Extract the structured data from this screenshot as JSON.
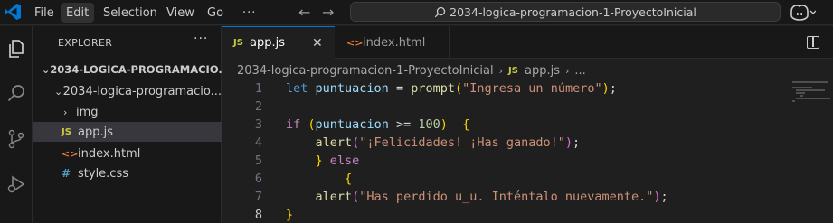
{
  "titlebar": {
    "menu": [
      "File",
      "Edit",
      "Selection",
      "View",
      "Go"
    ],
    "more": "···",
    "search_text": "2034-logica-programacion-1-ProyectoInicial",
    "brand_color": "#0078d4"
  },
  "explorer": {
    "title": "EXPLORER",
    "more": "···",
    "root_label": "2034-LOGICA-PROGRAMACIO...",
    "folder_label": "2034-logica-programacio...",
    "items": [
      {
        "label": "img",
        "type": "folder"
      },
      {
        "label": "app.js",
        "type": "js",
        "icon": "JS"
      },
      {
        "label": "index.html",
        "type": "html",
        "icon": "<>"
      },
      {
        "label": "style.css",
        "type": "css",
        "icon": "#"
      }
    ]
  },
  "tabs": [
    {
      "label": "app.js",
      "icon": "JS",
      "close": "✕"
    },
    {
      "label": "index.html",
      "icon": "<>"
    }
  ],
  "breadcrumb": {
    "root": "2034-logica-programacion-1-ProyectoInicial",
    "file_icon": "JS",
    "file": "app.js",
    "tail": "..."
  },
  "code": {
    "line_numbers": [
      "1",
      "2",
      "3",
      "4",
      "5",
      "6",
      "7",
      "8"
    ],
    "lines": [
      "let puntuacion = prompt(\"Ingresa un número\");",
      "",
      "if (puntuacion >= 100)  {",
      "    alert(\"¡Felicidades! ¡Has ganado!\");",
      "    } else",
      "        {",
      "    alert(\"Has perdido u_u. Inténtalo nuevamente.\");",
      "}"
    ]
  }
}
